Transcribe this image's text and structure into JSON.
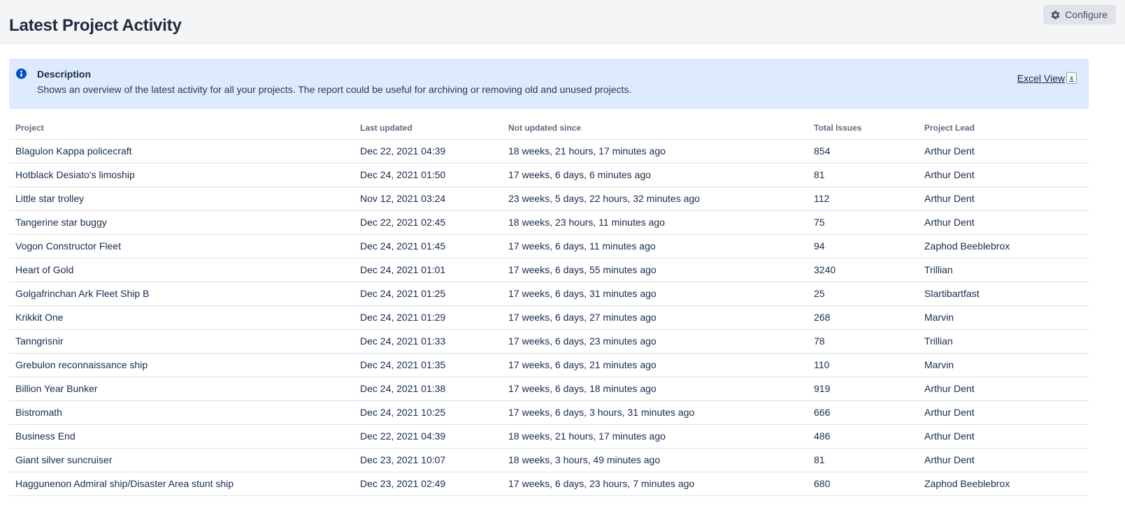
{
  "page": {
    "title": "Latest Project Activity"
  },
  "toolbar": {
    "configure_label": "Configure"
  },
  "info_panel": {
    "title": "Description",
    "body": "Shows an overview of the latest activity for all your projects. The report could be useful for archiving or removing old and unused projects.",
    "excel_view_label": "Excel View",
    "excel_icon_letter": "x"
  },
  "table": {
    "columns": [
      "Project",
      "Last updated",
      "Not updated since",
      "Total Issues",
      "Project Lead"
    ],
    "rows": [
      {
        "project": "Blagulon Kappa policecraft",
        "last_updated": "Dec 22, 2021 04:39",
        "not_updated_since": "18 weeks, 21 hours, 17 minutes ago",
        "total_issues": "854",
        "project_lead": "Arthur Dent"
      },
      {
        "project": "Hotblack Desiato's limoship",
        "last_updated": "Dec 24, 2021 01:50",
        "not_updated_since": "17 weeks, 6 days, 6 minutes ago",
        "total_issues": "81",
        "project_lead": "Arthur Dent"
      },
      {
        "project": "Little star trolley",
        "last_updated": "Nov 12, 2021 03:24",
        "not_updated_since": "23 weeks, 5 days, 22 hours, 32 minutes ago",
        "total_issues": "112",
        "project_lead": "Arthur Dent"
      },
      {
        "project": "Tangerine star buggy",
        "last_updated": "Dec 22, 2021 02:45",
        "not_updated_since": "18 weeks, 23 hours, 11 minutes ago",
        "total_issues": "75",
        "project_lead": "Arthur Dent"
      },
      {
        "project": "Vogon Constructor Fleet",
        "last_updated": "Dec 24, 2021 01:45",
        "not_updated_since": "17 weeks, 6 days, 11 minutes ago",
        "total_issues": "94",
        "project_lead": "Zaphod Beeblebrox"
      },
      {
        "project": "Heart of Gold",
        "last_updated": "Dec 24, 2021 01:01",
        "not_updated_since": "17 weeks, 6 days, 55 minutes ago",
        "total_issues": "3240",
        "project_lead": "Trillian"
      },
      {
        "project": "Golgafrinchan Ark Fleet Ship B",
        "last_updated": "Dec 24, 2021 01:25",
        "not_updated_since": "17 weeks, 6 days, 31 minutes ago",
        "total_issues": "25",
        "project_lead": "Slartibartfast"
      },
      {
        "project": "Krikkit One",
        "last_updated": "Dec 24, 2021 01:29",
        "not_updated_since": "17 weeks, 6 days, 27 minutes ago",
        "total_issues": "268",
        "project_lead": "Marvin"
      },
      {
        "project": "Tanngrisnir",
        "last_updated": "Dec 24, 2021 01:33",
        "not_updated_since": "17 weeks, 6 days, 23 minutes ago",
        "total_issues": "78",
        "project_lead": "Trillian"
      },
      {
        "project": "Grebulon reconnaissance ship",
        "last_updated": "Dec 24, 2021 01:35",
        "not_updated_since": "17 weeks, 6 days, 21 minutes ago",
        "total_issues": "110",
        "project_lead": "Marvin"
      },
      {
        "project": "Billion Year Bunker",
        "last_updated": "Dec 24, 2021 01:38",
        "not_updated_since": "17 weeks, 6 days, 18 minutes ago",
        "total_issues": "919",
        "project_lead": "Arthur Dent"
      },
      {
        "project": "Bistromath",
        "last_updated": "Dec 24, 2021 10:25",
        "not_updated_since": "17 weeks, 6 days, 3 hours, 31 minutes ago",
        "total_issues": "666",
        "project_lead": "Arthur Dent"
      },
      {
        "project": "Business End",
        "last_updated": "Dec 22, 2021 04:39",
        "not_updated_since": "18 weeks, 21 hours, 17 minutes ago",
        "total_issues": "486",
        "project_lead": "Arthur Dent"
      },
      {
        "project": "Giant silver suncruiser",
        "last_updated": "Dec 23, 2021 10:07",
        "not_updated_since": "18 weeks, 3 hours, 49 minutes ago",
        "total_issues": "81",
        "project_lead": "Arthur Dent"
      },
      {
        "project": "Haggunenon Admiral ship/Disaster Area stunt ship",
        "last_updated": "Dec 23, 2021 02:49",
        "not_updated_since": "17 weeks, 6 days, 23 hours, 7 minutes ago",
        "total_issues": "680",
        "project_lead": "Zaphod Beeblebrox"
      }
    ]
  },
  "colors": {
    "header_band_bg": "#f4f5f7",
    "info_panel_bg": "#deebff",
    "info_icon_blue": "#0052cc",
    "body_text": "#172b4d",
    "column_header_text": "#5e6c84",
    "row_border": "#dfe1e6",
    "button_text": "#42526e",
    "excel_icon_green": "#1d7a3f"
  }
}
